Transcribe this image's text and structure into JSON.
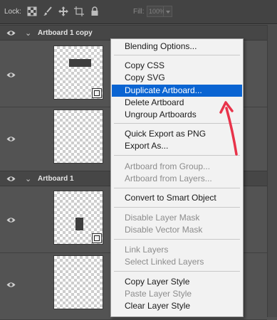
{
  "toolbar": {
    "lock_label": "Lock:",
    "fill_label": "Fill:",
    "fill_value": "100%",
    "icons": [
      "lock-transparent-icon",
      "lock-brush-icon",
      "lock-move-icon",
      "lock-artboard-icon",
      "lock-all-icon"
    ]
  },
  "layers": {
    "groups": [
      {
        "name": "Artboard 1 copy"
      },
      {
        "name": "Artboard 1"
      }
    ]
  },
  "context_menu": {
    "items": [
      {
        "label": "Blending Options...",
        "enabled": true
      },
      {
        "label": "Copy CSS",
        "enabled": true
      },
      {
        "label": "Copy SVG",
        "enabled": true
      },
      {
        "label": "Duplicate Artboard...",
        "enabled": true,
        "highlighted": true
      },
      {
        "label": "Delete Artboard",
        "enabled": true
      },
      {
        "label": "Ungroup Artboards",
        "enabled": true
      },
      {
        "label": "Quick Export as PNG",
        "enabled": true
      },
      {
        "label": "Export As...",
        "enabled": true
      },
      {
        "label": "Artboard from Group...",
        "enabled": false
      },
      {
        "label": "Artboard from Layers...",
        "enabled": false
      },
      {
        "label": "Convert to Smart Object",
        "enabled": true
      },
      {
        "label": "Disable Layer Mask",
        "enabled": false
      },
      {
        "label": "Disable Vector Mask",
        "enabled": false
      },
      {
        "label": "Link Layers",
        "enabled": false
      },
      {
        "label": "Select Linked Layers",
        "enabled": false
      },
      {
        "label": "Copy Layer Style",
        "enabled": true
      },
      {
        "label": "Paste Layer Style",
        "enabled": false
      },
      {
        "label": "Clear Layer Style",
        "enabled": true
      }
    ]
  },
  "colors": {
    "highlight": "#0a64d2",
    "annotation_arrow": "#e8334a"
  }
}
